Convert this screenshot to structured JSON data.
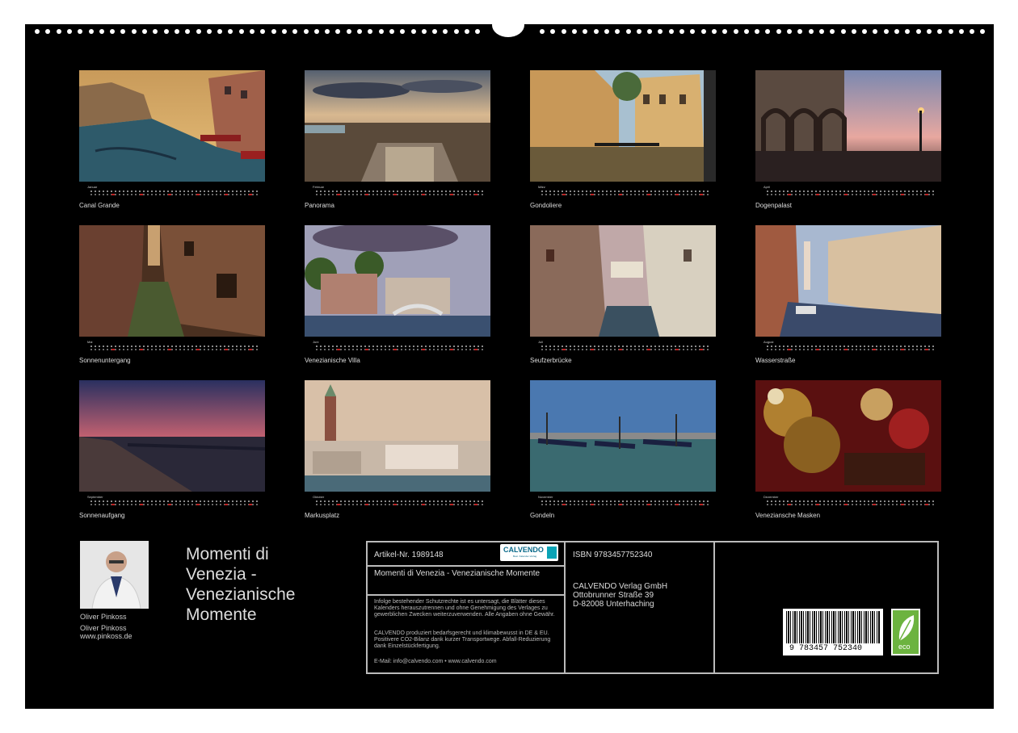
{
  "calendar": {
    "months": [
      {
        "name": "Januar",
        "caption": "Canal Grande"
      },
      {
        "name": "Februar",
        "caption": "Panorama"
      },
      {
        "name": "März",
        "caption": "Gondoliere"
      },
      {
        "name": "April",
        "caption": "Dogenpalast"
      },
      {
        "name": "Mai",
        "caption": "Sonnenuntergang"
      },
      {
        "name": "Juni",
        "caption": "Venezianische Villa"
      },
      {
        "name": "Juli",
        "caption": "Seufzerbrücke"
      },
      {
        "name": "August",
        "caption": "Wasserstraße"
      },
      {
        "name": "September",
        "caption": "Sonnenaufgang"
      },
      {
        "name": "Oktober",
        "caption": "Markusplatz"
      },
      {
        "name": "November",
        "caption": "Gondeln"
      },
      {
        "name": "Dezember",
        "caption": "Veneziansche Masken"
      }
    ]
  },
  "author": {
    "name_1": "Oliver Pinkoss",
    "name_2": "Oliver Pinkoss",
    "website": "www.pinkoss.de"
  },
  "title": {
    "line_1": "Momenti di",
    "line_2": "Venezia -",
    "line_3": "Venezianische",
    "line_4": "Momente"
  },
  "info": {
    "artikel": "Artikel-Nr. 1989148",
    "logo_text": "CALVENDO",
    "logo_subtext": "Best. Kalender-Verlag",
    "product_title": "Momenti di Venezia - Venezianische Momente",
    "rights_text": "Infolge bestehender Schutzrechte ist es untersagt, die Blätter dieses Kalenders herauszutrennen und ohne Genehmigung des Verlages zu gewerblichen Zwecken weiterzuverwenden. Alle Angaben ohne Gewähr.",
    "eco_text": "CALVENDO produziert bedarfsgerecht und klimabewusst in DE & EU. Positivere CO2-Bilanz dank kurzer Transportwege. Abfall-Reduzierung dank Einzelstückfertigung.",
    "email": "E-Mail: info@calvendo.com • www.calvendo.com",
    "isbn": "ISBN 9783457752340",
    "publisher": "CALVENDO Verlag GmbH",
    "street": "Ottobrunner Straße 39",
    "city": "D-82008 Unterhaching",
    "barcode_digits": "9 783457 752340",
    "eco_label": "eco"
  },
  "colors": {
    "background": "#000000",
    "text": "#dddddd",
    "border": "#bbbbbb",
    "eco_green": "#6cb33f",
    "calvendo_teal": "#0aa3b5"
  }
}
